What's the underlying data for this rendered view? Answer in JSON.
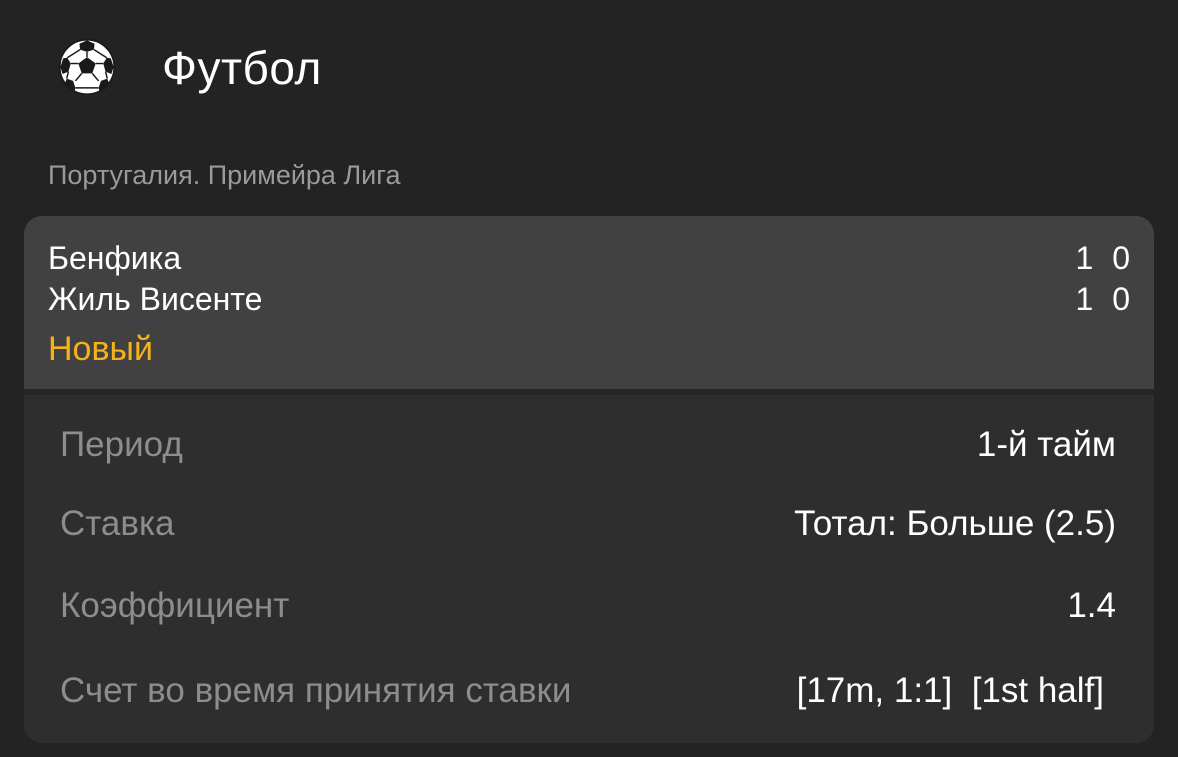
{
  "header": {
    "icon": "soccer-ball-icon",
    "title": "Футбол"
  },
  "league": "Португалия. Примейра Лига",
  "match": {
    "team1": {
      "name": "Бенфика",
      "score": "1 0"
    },
    "team2": {
      "name": "Жиль Висенте",
      "score": "1 0"
    },
    "status": "Новый",
    "status_color": "#f5b21c"
  },
  "details": [
    {
      "label": "Период",
      "value": "1-й тайм"
    },
    {
      "label": "Ставка",
      "value": "Тотал: Больше (2.5)"
    },
    {
      "label": "Коэффициент",
      "value": "1.4"
    },
    {
      "label": "Счет во время принятия ставки",
      "value": "[17m, 1:1]  [1st half]"
    }
  ],
  "colors": {
    "background": "#232323",
    "card": "#2e2e2e",
    "match_block": "#414141",
    "label": "#8d8d8d",
    "muted": "#9a9a9a"
  }
}
